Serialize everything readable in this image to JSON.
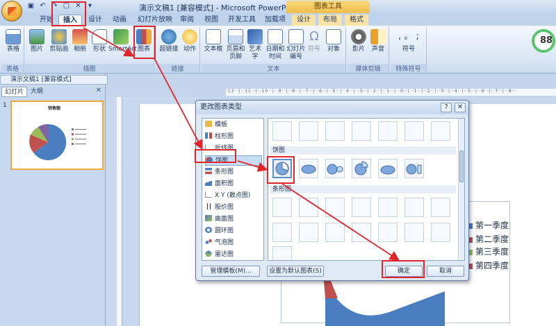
{
  "window": {
    "title": "演示文稿1 [兼容模式] - Microsoft PowerPoint",
    "tool_context": "图表工具"
  },
  "tabs": [
    "开始",
    "插入",
    "设计",
    "动画",
    "幻灯片放映",
    "审阅",
    "视图",
    "开发工具",
    "加载项",
    "设计",
    "布局",
    "格式"
  ],
  "ribbon": {
    "groups": [
      "表格",
      "插图",
      "链接",
      "文本",
      "媒体剪辑",
      "特殊符号"
    ],
    "buttons": [
      "表格",
      "图片",
      "剪贴画",
      "相册",
      "形状",
      "SmartArt",
      "图表",
      "超链接",
      "动作",
      "文本框",
      "页眉和页脚",
      "艺术字",
      "日期和时间",
      "幻灯片编号",
      "符号",
      "对象",
      "影片",
      "声音",
      "符号"
    ],
    "zoom_badge": "88"
  },
  "document_tab": "演示文稿1 [兼容模式]",
  "pane": {
    "tabs": [
      "幻灯片",
      "大纲"
    ],
    "slide_number": "1",
    "thumb_title": "销售额"
  },
  "dialog": {
    "title": "更改图表类型",
    "chart_types": [
      "模板",
      "柱形图",
      "折线图",
      "饼图",
      "条形图",
      "面积图",
      "X Y (散点图)",
      "股价图",
      "曲面图",
      "圆环图",
      "气泡图",
      "雷达图"
    ],
    "selected_type": "饼图",
    "sections": [
      "饼图",
      "条形图"
    ],
    "buttons": {
      "manage": "管理模板(M)...",
      "set_default": "设置为默认图表(S)",
      "ok": "确定",
      "cancel": "取消"
    }
  },
  "legend": [
    "第一季度",
    "第二季度",
    "第三季度",
    "第四季度"
  ],
  "colors": {
    "q1": "#4a7ec0",
    "q2": "#c0504d",
    "q3": "#9bbb59",
    "q4": "#8064a2",
    "accent_red": "#e0262a"
  }
}
